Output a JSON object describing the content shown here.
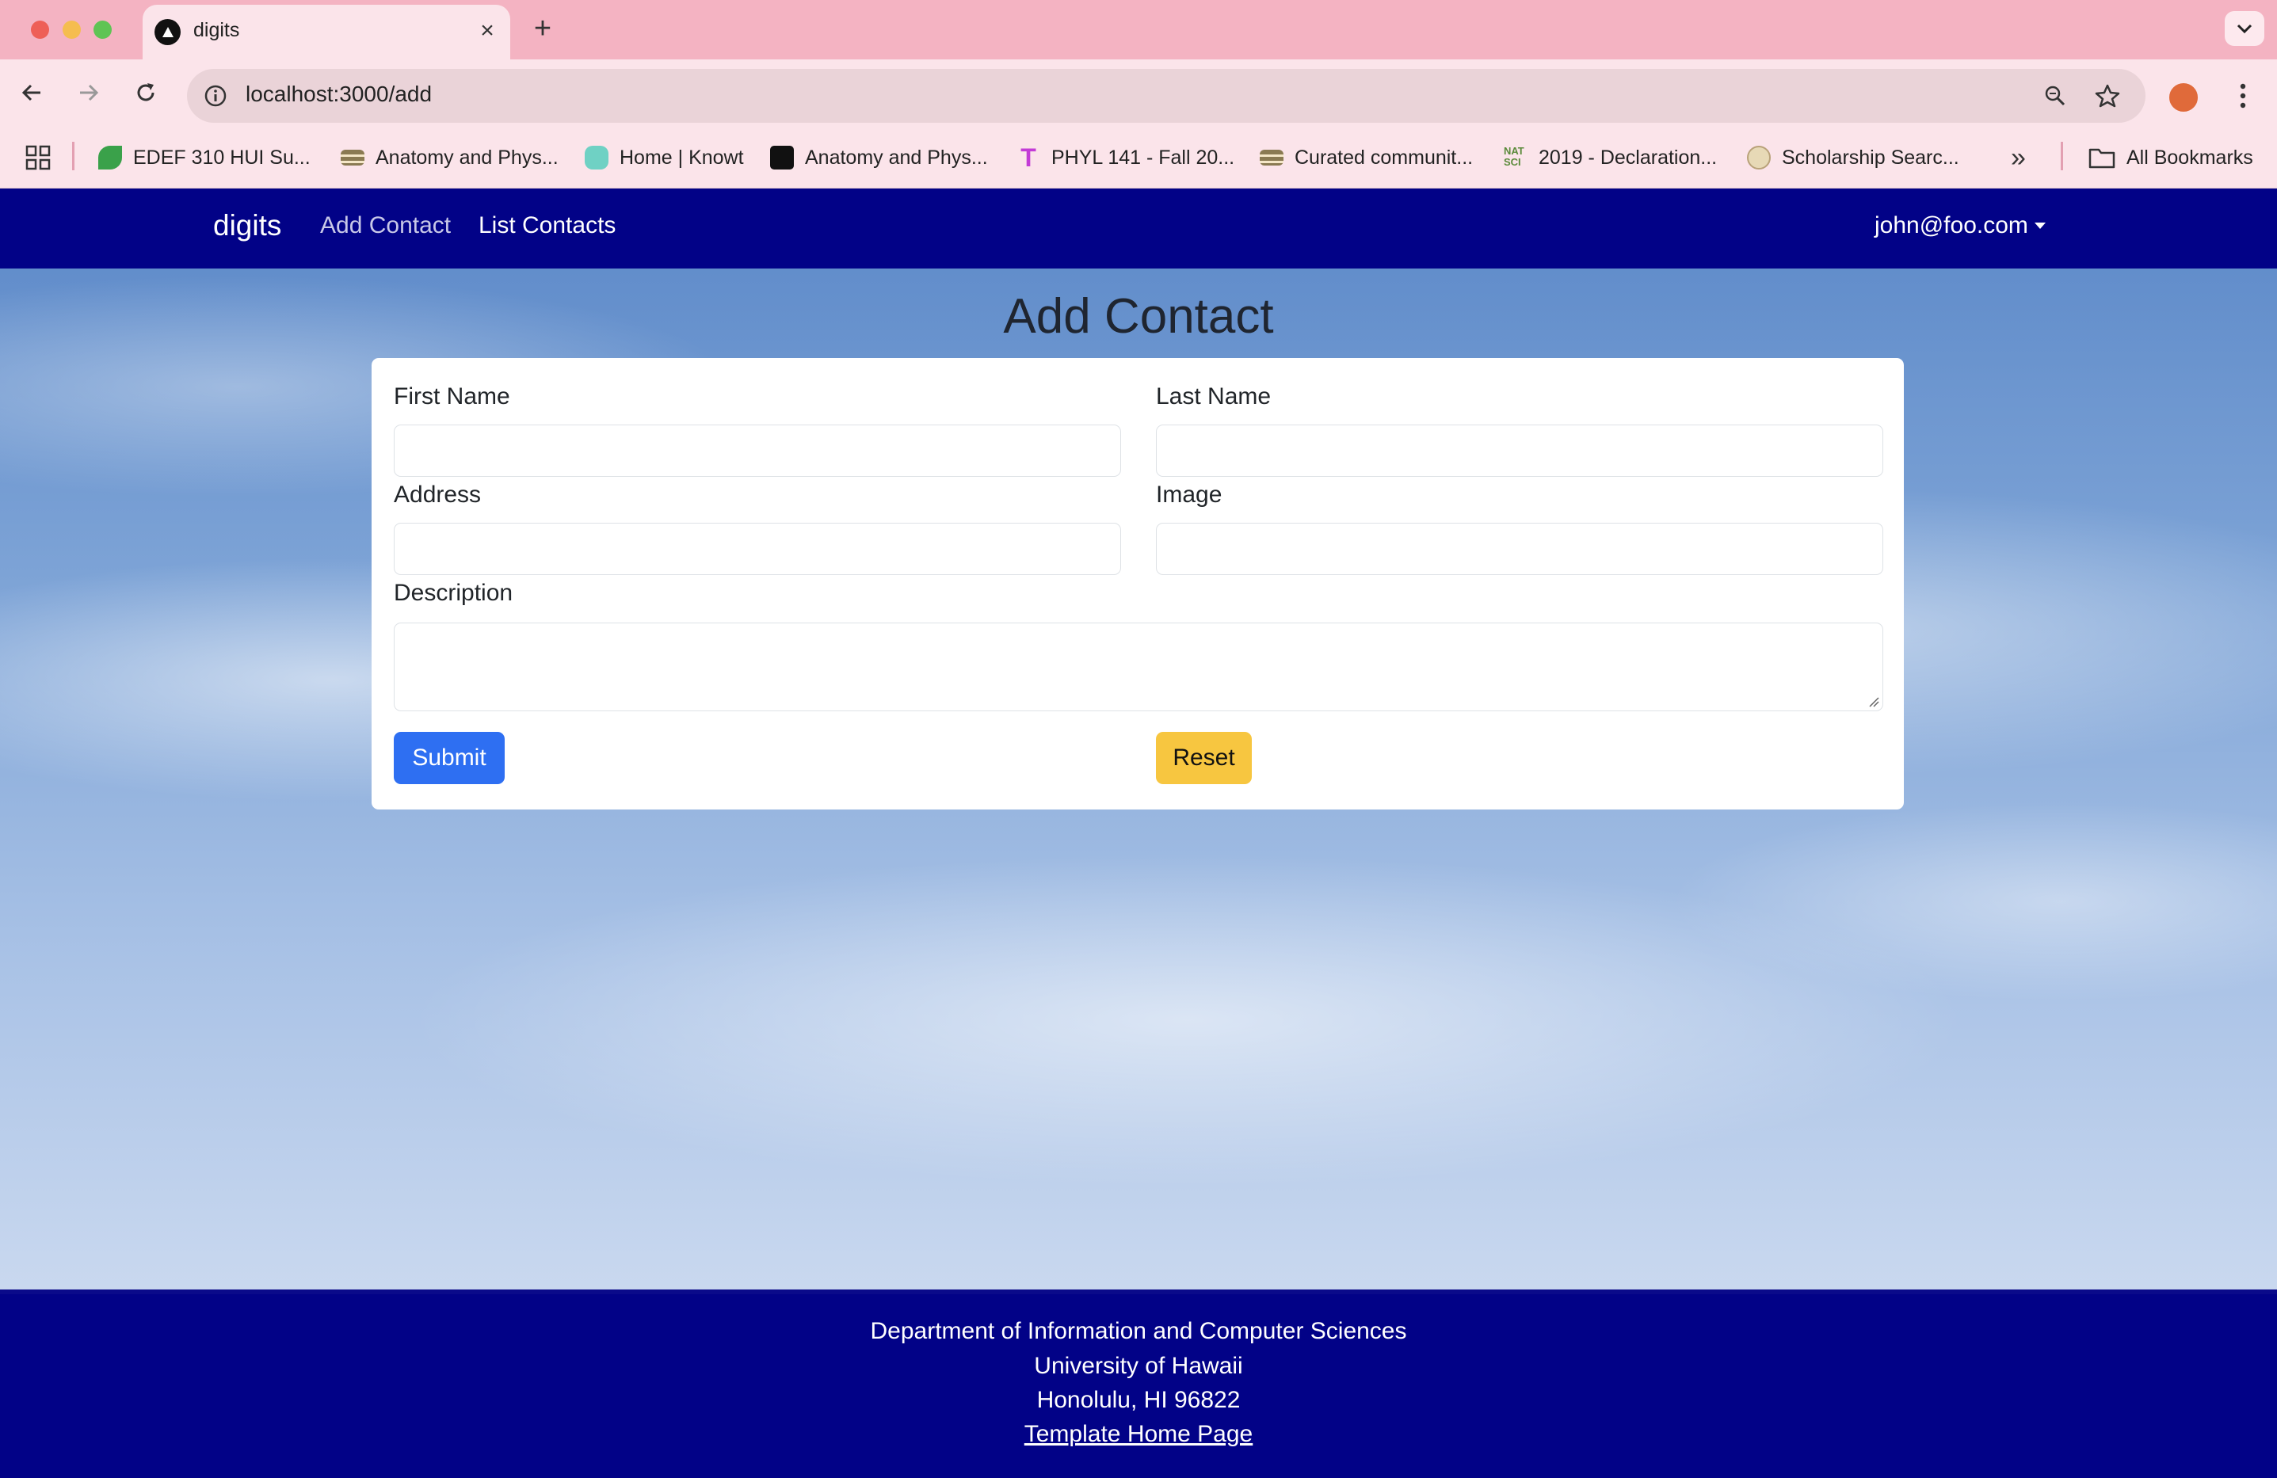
{
  "browser": {
    "tab_title": "digits",
    "url": "localhost:3000/add",
    "bookmarks": [
      {
        "label": "EDEF 310 HUI Su...",
        "icon": "leaf-icon",
        "color": "#3aa14a"
      },
      {
        "label": "Anatomy and Phys...",
        "icon": "books-icon",
        "color": "#8a7a52"
      },
      {
        "label": "Home | Knowt",
        "icon": "knowt-icon",
        "color": "#6fd1c4"
      },
      {
        "label": "Anatomy and Phys...",
        "icon": "quizlet-icon",
        "color": "#111111"
      },
      {
        "label": "PHYL 141 - Fall 20...",
        "icon": "t-icon",
        "color": "#c33bd6"
      },
      {
        "label": "Curated communit...",
        "icon": "books-icon",
        "color": "#8a7a52"
      },
      {
        "label": "2019 - Declaration...",
        "icon": "natsci-icon",
        "color": "#5a8a3a"
      },
      {
        "label": "Scholarship Searc...",
        "icon": "seal-icon",
        "color": "#b9a27a"
      }
    ],
    "all_bookmarks_label": "All Bookmarks"
  },
  "navbar": {
    "brand": "digits",
    "links": [
      "Add Contact",
      "List Contacts"
    ],
    "user": "john@foo.com"
  },
  "form": {
    "title": "Add Contact",
    "labels": {
      "first_name": "First Name",
      "last_name": "Last Name",
      "address": "Address",
      "image": "Image",
      "description": "Description"
    },
    "values": {
      "first_name": "",
      "last_name": "",
      "address": "",
      "image": "",
      "description": ""
    },
    "submit_label": "Submit",
    "reset_label": "Reset"
  },
  "footer": {
    "lines": [
      "Department of Information and Computer Sciences",
      "University of Hawaii",
      "Honolulu, HI 96822"
    ],
    "link_label": "Template Home Page"
  },
  "colors": {
    "navbar": "#020287",
    "submit": "#2e6ff2",
    "reset": "#f7c640",
    "tabbar": "#f4b3c2"
  }
}
